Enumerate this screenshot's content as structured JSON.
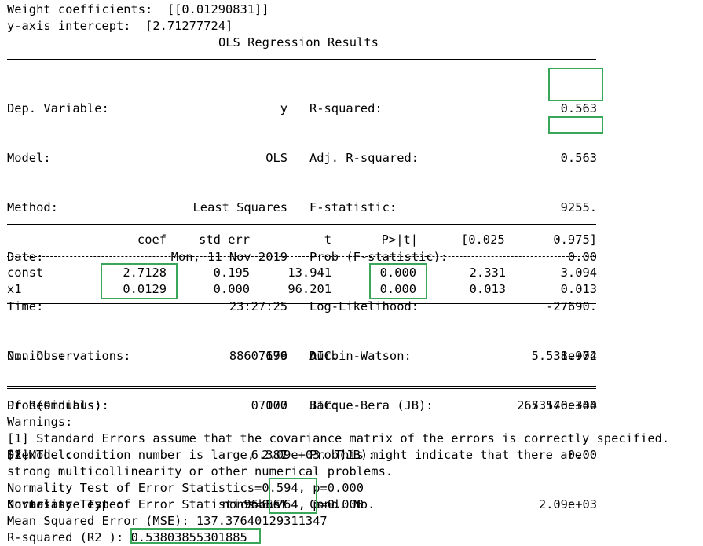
{
  "header": {
    "weight_line": "Weight coefficients:  [[0.01290831]]",
    "intercept_line": "y-axis intercept:  [2.71277724]",
    "title": "OLS Regression Results"
  },
  "summary": {
    "left": [
      {
        "label": "Dep. Variable:",
        "value": "y"
      },
      {
        "label": "Model:",
        "value": "OLS"
      },
      {
        "label": "Method:",
        "value": "Least Squares"
      },
      {
        "label": "Date:",
        "value": "Mon, 11 Nov 2019"
      },
      {
        "label": "Time:",
        "value": "23:27:25"
      },
      {
        "label": "No. Observations:",
        "value": "7179"
      },
      {
        "label": "Df Residuals:",
        "value": "7177"
      },
      {
        "label": "Df Model:",
        "value": "1"
      },
      {
        "label": "Covariance Type:",
        "value": "nonrobust"
      }
    ],
    "right": [
      {
        "label": "R-squared:",
        "value": "0.563"
      },
      {
        "label": "Adj. R-squared:",
        "value": "0.563"
      },
      {
        "label": "F-statistic:",
        "value": "9255."
      },
      {
        "label": "Prob (F-statistic):",
        "value": "0.00"
      },
      {
        "label": "Log-Likelihood:",
        "value": "-27690."
      },
      {
        "label": "AIC:",
        "value": "5.538e+04"
      },
      {
        "label": "BIC:",
        "value": "5.540e+04"
      }
    ]
  },
  "coef_table": {
    "headers": [
      "coef",
      "std err",
      "t",
      "P>|t|",
      "[0.025",
      "0.975]"
    ],
    "rows": [
      {
        "name": "const",
        "values": [
          "2.7128",
          "0.195",
          "13.941",
          "0.000",
          "2.331",
          "3.094"
        ]
      },
      {
        "name": "x1",
        "values": [
          "0.0129",
          "0.000",
          "96.201",
          "0.000",
          "0.013",
          "0.013"
        ]
      }
    ]
  },
  "diagnostics": {
    "left": [
      {
        "label": "Omnibus:",
        "value": "8860.696"
      },
      {
        "label": "Prob(Omnibus):",
        "value": "0.000"
      },
      {
        "label": "Skew:",
        "value": "6.387"
      },
      {
        "label": "Kurtosis:",
        "value": "96.667"
      }
    ],
    "right": [
      {
        "label": "Durbin-Watson:",
        "value": "1.972"
      },
      {
        "label": "Jarque-Bera (JB):",
        "value": "2673176.340"
      },
      {
        "label": "Prob(JB):",
        "value": "0.00"
      },
      {
        "label": "Cond. No.",
        "value": "2.09e+03"
      }
    ]
  },
  "warnings": {
    "title": "Warnings:",
    "line1": "[1] Standard Errors assume that the covariance matrix of the errors is correctly specified.",
    "line2": "[2] The condition number is large, 2.09e+03. This might indicate that there are",
    "line3": "strong multicollinearity or other numerical problems."
  },
  "extra": {
    "normality_1": {
      "prefix": "Normality Test of Error Statistics=",
      "value": "0.594,",
      "suffix": " p=0.000"
    },
    "normality_2": {
      "prefix": "Normality Test of Error Statistics=",
      "value": "0.764,",
      "suffix": " p=0.000"
    },
    "mse_line": "Mean Squared Error (MSE): 137.37640129311347",
    "r2": {
      "prefix": "R-squared (R2 ):",
      "value": " 0.53803855301885"
    }
  },
  "highlight_color": "#3aa65a"
}
